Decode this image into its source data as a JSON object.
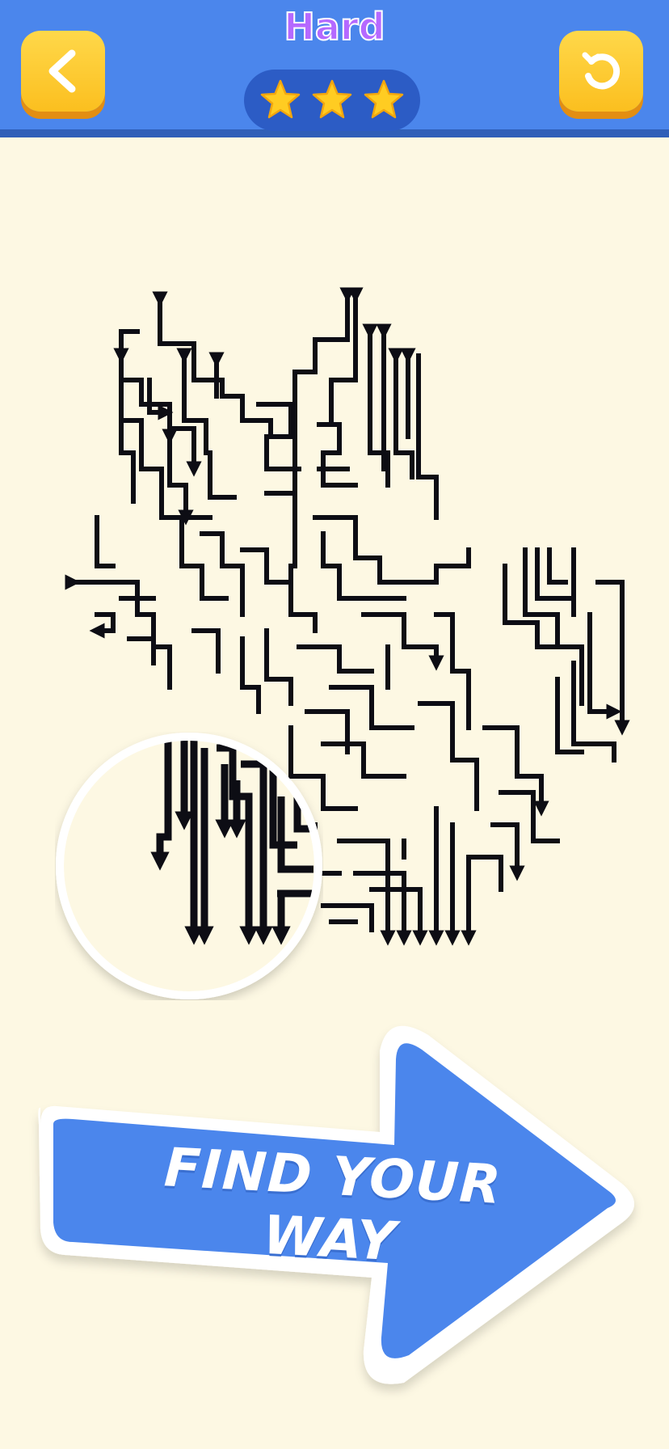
{
  "header": {
    "level_label": "Hard",
    "back_icon": "chevron-left-icon",
    "restart_icon": "restart-icon",
    "stars_filled": 3,
    "stars_total": 3,
    "star_color": "#ffcc22",
    "bar_color": "#4b86ec"
  },
  "puzzle": {
    "type": "arrow-maze",
    "theme_shape": "cat",
    "line_color": "#0d0d14",
    "background": "#fdf8e3"
  },
  "promo": {
    "banner_text": "FIND YOUR WAY",
    "arrow_color": "#4b86ec"
  }
}
